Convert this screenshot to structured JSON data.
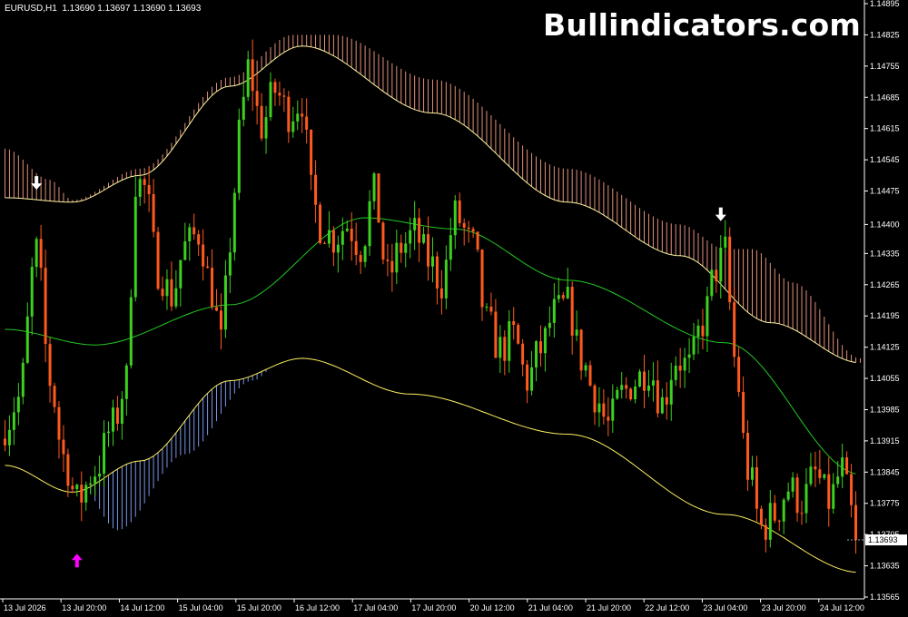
{
  "header": {
    "symbol_info": "EURUSD,H1  1.13690 1.13697 1.13690 1.13693",
    "brand": "Bullindicators.com"
  },
  "chart_data": {
    "type": "candlestick",
    "symbol": "EURUSD",
    "timeframe": "H1",
    "ohlc_current": {
      "open": 1.1369,
      "high": 1.13697,
      "low": 1.1369,
      "close": 1.13693
    },
    "current_price_label": "1.13693",
    "ylim": [
      1.13565,
      1.14895
    ],
    "y_ticks": [
      "1.14895",
      "1.14825",
      "1.14755",
      "1.14685",
      "1.14615",
      "1.14545",
      "1.14475",
      "1.14400",
      "1.14335",
      "1.14265",
      "1.14195",
      "1.14125",
      "1.14055",
      "1.13985",
      "1.13915",
      "1.13845",
      "1.13775",
      "1.13705",
      "1.13635",
      "1.13565"
    ],
    "x_ticks": [
      "13 Jul 2026",
      "13 Jul 20:00",
      "14 Jul 12:00",
      "15 Jul 04:00",
      "15 Jul 20:00",
      "16 Jul 12:00",
      "17 Jul 04:00",
      "17 Jul 20:00",
      "20 Jul 12:00",
      "21 Jul 04:00",
      "21 Jul 20:00",
      "22 Jul 12:00",
      "23 Jul 04:00",
      "23 Jul 20:00",
      "24 Jul 12:00"
    ],
    "bars": 190,
    "bull_color": "#3cd11e",
    "bear_color": "#ff5a1e",
    "middle_band": [
      [
        0,
        1.14165
      ],
      [
        20,
        1.1413
      ],
      [
        50,
        1.1422
      ],
      [
        80,
        1.14415
      ],
      [
        100,
        1.1439
      ],
      [
        125,
        1.14275
      ],
      [
        160,
        1.14135
      ],
      [
        190,
        1.1384
      ]
    ],
    "upper_band": [
      [
        0,
        1.1446
      ],
      [
        15,
        1.1445
      ],
      [
        30,
        1.1451
      ],
      [
        50,
        1.1471
      ],
      [
        66,
        1.148
      ],
      [
        95,
        1.1465
      ],
      [
        125,
        1.1445
      ],
      [
        150,
        1.1433
      ],
      [
        170,
        1.1418
      ],
      [
        190,
        1.1409
      ]
    ],
    "lower_band": [
      [
        0,
        1.1386
      ],
      [
        15,
        1.138
      ],
      [
        30,
        1.1387
      ],
      [
        50,
        1.1405
      ],
      [
        66,
        1.141
      ],
      [
        90,
        1.1402
      ],
      [
        125,
        1.1393
      ],
      [
        160,
        1.1375
      ],
      [
        190,
        1.1362
      ]
    ],
    "upper_envelope": [
      [
        0,
        1.1457
      ],
      [
        10,
        1.145
      ],
      [
        15,
        1.14455
      ],
      [
        30,
        1.14525
      ],
      [
        50,
        1.1473
      ],
      [
        64,
        1.14825
      ],
      [
        73,
        1.14825
      ],
      [
        95,
        1.14725
      ],
      [
        125,
        1.14525
      ],
      [
        150,
        1.144
      ],
      [
        160,
        1.14345
      ],
      [
        166,
        1.14345
      ],
      [
        175,
        1.1427
      ],
      [
        190,
        1.141
      ]
    ],
    "lower_envelope": [
      [
        17,
        1.1381
      ],
      [
        25,
        1.13715
      ],
      [
        40,
        1.13885
      ],
      [
        55,
        1.1405
      ],
      [
        62,
        1.141
      ]
    ],
    "arrows": [
      {
        "bar": 7,
        "direction": "down",
        "color": "#ffffff",
        "price": 1.1449
      },
      {
        "bar": 16,
        "direction": "up",
        "color": "#ff00ff",
        "price": 1.1365
      },
      {
        "bar": 159,
        "direction": "down",
        "color": "#ffffff",
        "price": 1.1442
      }
    ],
    "close_path": [
      [
        0,
        1.1395
      ],
      [
        3,
        1.1401
      ],
      [
        7,
        1.1434
      ],
      [
        10,
        1.1405
      ],
      [
        13,
        1.1388
      ],
      [
        16,
        1.1378
      ],
      [
        20,
        1.1385
      ],
      [
        24,
        1.1395
      ],
      [
        27,
        1.1405
      ],
      [
        29,
        1.145
      ],
      [
        31,
        1.1448
      ],
      [
        34,
        1.143
      ],
      [
        37,
        1.1424
      ],
      [
        40,
        1.1435
      ],
      [
        43,
        1.1438
      ],
      [
        46,
        1.1425
      ],
      [
        48,
        1.1413
      ],
      [
        50,
        1.1436
      ],
      [
        52,
        1.146
      ],
      [
        54,
        1.1475
      ],
      [
        57,
        1.1462
      ],
      [
        60,
        1.147
      ],
      [
        63,
        1.1465
      ],
      [
        66,
        1.1468
      ],
      [
        68,
        1.1447
      ],
      [
        70,
        1.144
      ],
      [
        73,
        1.1437
      ],
      [
        76,
        1.144
      ],
      [
        79,
        1.1435
      ],
      [
        82,
        1.1447
      ],
      [
        85,
        1.1428
      ],
      [
        88,
        1.1435
      ],
      [
        91,
        1.1438
      ],
      [
        94,
        1.1432
      ],
      [
        97,
        1.1427
      ],
      [
        100,
        1.1442
      ],
      [
        104,
        1.1435
      ],
      [
        107,
        1.1418
      ],
      [
        110,
        1.1412
      ],
      [
        113,
        1.1415
      ],
      [
        116,
        1.1405
      ],
      [
        119,
        1.1412
      ],
      [
        122,
        1.142
      ],
      [
        125,
        1.1422
      ],
      [
        128,
        1.141
      ],
      [
        131,
        1.1402
      ],
      [
        134,
        1.1395
      ],
      [
        137,
        1.1402
      ],
      [
        140,
        1.1405
      ],
      [
        143,
        1.1408
      ],
      [
        146,
        1.14
      ],
      [
        149,
        1.141
      ],
      [
        152,
        1.1408
      ],
      [
        155,
        1.1418
      ],
      [
        158,
        1.143
      ],
      [
        160,
        1.1434
      ],
      [
        162,
        1.141
      ],
      [
        165,
        1.1385
      ],
      [
        168,
        1.1372
      ],
      [
        171,
        1.1375
      ],
      [
        174,
        1.1381
      ],
      [
        177,
        1.1378
      ],
      [
        180,
        1.1384
      ],
      [
        183,
        1.1378
      ],
      [
        186,
        1.1385
      ],
      [
        188,
        1.1375
      ],
      [
        190,
        1.13693
      ]
    ]
  }
}
